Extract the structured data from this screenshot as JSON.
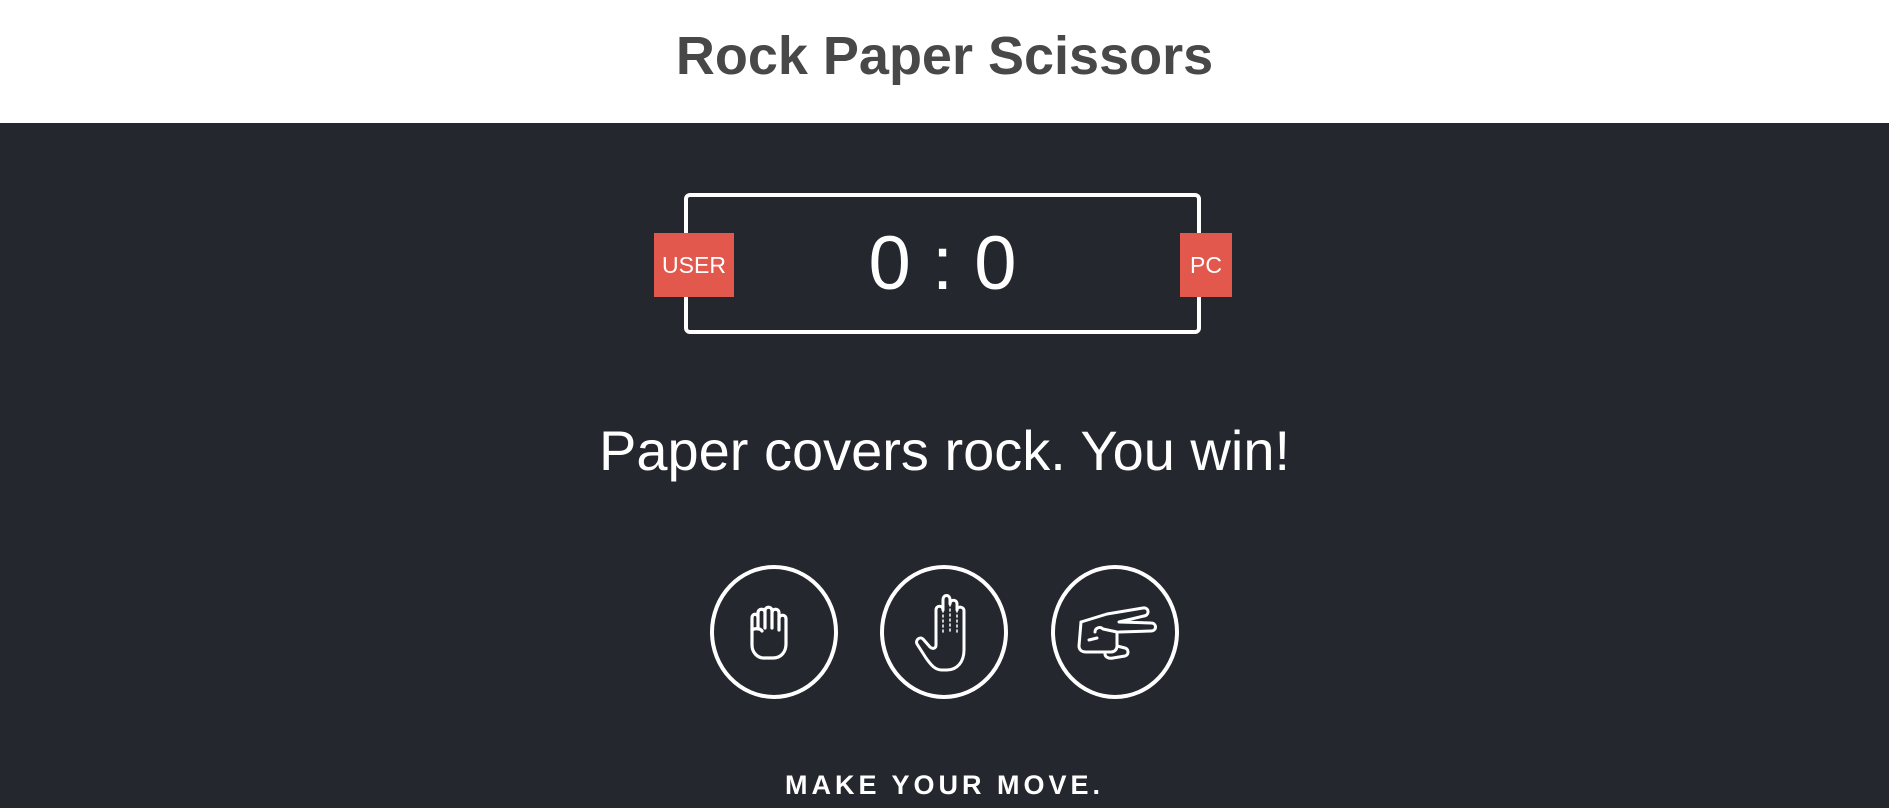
{
  "header": {
    "title": "Rock Paper Scissors"
  },
  "scoreboard": {
    "user_label": "USER",
    "pc_label": "PC",
    "user_score": "0",
    "separator": ":",
    "pc_score": "0"
  },
  "result": {
    "message": "Paper covers rock. You win!"
  },
  "choices": [
    {
      "name": "rock",
      "icon": "fist-icon"
    },
    {
      "name": "paper",
      "icon": "open-hand-icon"
    },
    {
      "name": "scissors",
      "icon": "scissors-hand-icon"
    }
  ],
  "prompt": {
    "text": "MAKE YOUR MOVE."
  },
  "colors": {
    "background": "#25272E",
    "header_background": "#ffffff",
    "title": "#484848",
    "badge": "#E2584D",
    "foreground": "#ffffff"
  }
}
